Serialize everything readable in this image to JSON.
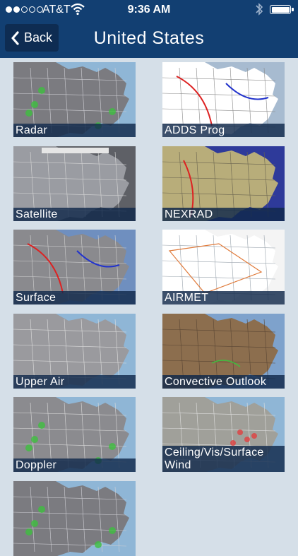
{
  "status": {
    "carrier": "AT&T",
    "time": "9:36 AM",
    "signal_bars_filled": 2,
    "signal_bars_total": 5
  },
  "nav": {
    "back_label": "Back",
    "title": "United States"
  },
  "tiles": [
    {
      "label": "Radar",
      "style": "radar"
    },
    {
      "label": "ADDS Prog",
      "style": "prog"
    },
    {
      "label": "Satellite",
      "style": "satellite"
    },
    {
      "label": "NEXRAD",
      "style": "nexrad"
    },
    {
      "label": "Surface",
      "style": "surface"
    },
    {
      "label": "AIRMET",
      "style": "airmet"
    },
    {
      "label": "Upper Air",
      "style": "upper"
    },
    {
      "label": "Convective Outlook",
      "style": "convective"
    },
    {
      "label": "Doppler",
      "style": "doppler"
    },
    {
      "label": "Ceiling/Vis/Surface Wind",
      "style": "ceiling"
    },
    {
      "label": "",
      "style": "radar"
    }
  ],
  "colors": {
    "header": "#123f72",
    "back_button": "#0e2c52",
    "background": "#d5dfe8",
    "label_bar": "#10284a"
  }
}
